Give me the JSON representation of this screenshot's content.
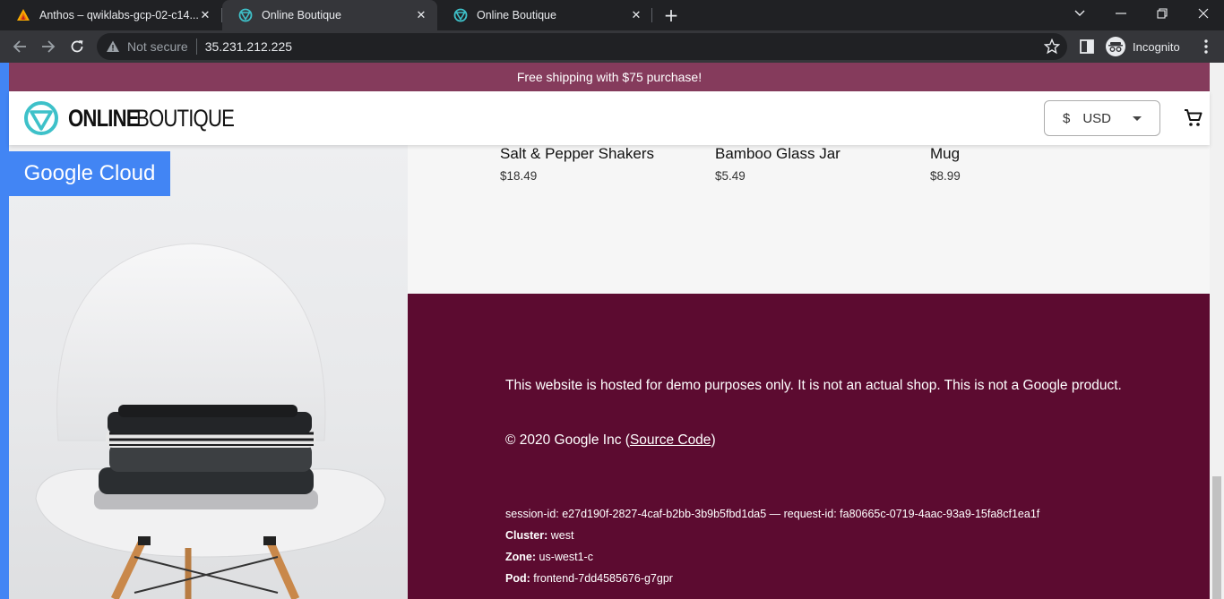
{
  "browser": {
    "tabs": [
      {
        "title": "Anthos – qwiklabs-gcp-02-c14...",
        "favicon": "anthos-triangle-icon"
      },
      {
        "title": "Online Boutique",
        "favicon": "boutique-logo-icon",
        "active": true
      },
      {
        "title": "Online Boutique",
        "favicon": "boutique-logo-icon"
      }
    ],
    "address": {
      "security_label": "Not secure",
      "url": "35.231.212.225"
    },
    "profile_label": "Incognito"
  },
  "site": {
    "banner": "Free shipping with $75 purchase!",
    "logo": {
      "bold": "ONLINE",
      "light": "BOUTIQUE"
    },
    "currency": {
      "symbol": "$",
      "code": "USD"
    },
    "hero_badge": "Google Cloud",
    "products": [
      {
        "name": "Salt & Pepper Shakers",
        "price": "$18.49"
      },
      {
        "name": "Bamboo Glass Jar",
        "price": "$5.49"
      },
      {
        "name": "Mug",
        "price": "$8.99"
      }
    ],
    "footer": {
      "disclaimer": "This website is hosted for demo purposes only. It is not an actual shop. This is not a Google product.",
      "copyright_prefix": "© 2020 Google Inc (",
      "source_link": "Source Code",
      "copyright_suffix": ")",
      "session_line": "session-id: e27d190f-2827-4caf-b2bb-3b9b5fbd1da5 — request-id: fa80665c-0719-4aac-93a9-15fa8cf1ea1f",
      "cluster_label": "Cluster:",
      "cluster_value": "west",
      "zone_label": "Zone:",
      "zone_value": "us-west1-c",
      "pod_label": "Pod:",
      "pod_value": "frontend-7dd4585676-g7gpr"
    }
  },
  "colors": {
    "banner": "#853b5c",
    "footer": "#5c0b30",
    "google_blue": "#4285f4",
    "logo_teal": "#3ec1c9"
  }
}
